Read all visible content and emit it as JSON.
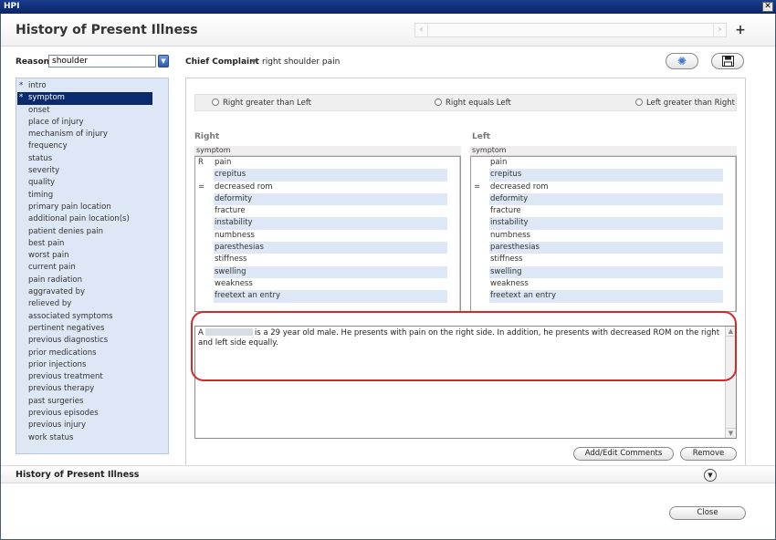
{
  "window": {
    "title": "HPI",
    "close_glyph": "✕"
  },
  "header": {
    "title": "History of Present Illness",
    "nav_left": "‹",
    "nav_right": "›",
    "add_glyph": "+"
  },
  "reason": {
    "label": "Reason:",
    "value": "shoulder"
  },
  "chief_complaint": {
    "label": "Chief Complaint",
    "value": "right shoulder pain"
  },
  "sidebar": {
    "items": [
      {
        "label": "intro",
        "star": "*"
      },
      {
        "label": "symptom",
        "star": "*"
      },
      {
        "label": "onset",
        "star": ""
      },
      {
        "label": "place of injury",
        "star": ""
      },
      {
        "label": "mechanism of injury",
        "star": ""
      },
      {
        "label": "frequency",
        "star": ""
      },
      {
        "label": "status",
        "star": ""
      },
      {
        "label": "severity",
        "star": ""
      },
      {
        "label": "quality",
        "star": ""
      },
      {
        "label": "timing",
        "star": ""
      },
      {
        "label": "primary pain location",
        "star": ""
      },
      {
        "label": "additional pain location(s)",
        "star": ""
      },
      {
        "label": "patient denies pain",
        "star": ""
      },
      {
        "label": "best pain",
        "star": ""
      },
      {
        "label": "worst pain",
        "star": ""
      },
      {
        "label": "current pain",
        "star": ""
      },
      {
        "label": "pain radiation",
        "star": ""
      },
      {
        "label": "aggravated by",
        "star": ""
      },
      {
        "label": "relieved by",
        "star": ""
      },
      {
        "label": "associated symptoms",
        "star": ""
      },
      {
        "label": "pertinent negatives",
        "star": ""
      },
      {
        "label": "previous diagnostics",
        "star": ""
      },
      {
        "label": "prior medications",
        "star": ""
      },
      {
        "label": "prior injections",
        "star": ""
      },
      {
        "label": "previous treatment",
        "star": ""
      },
      {
        "label": "previous therapy",
        "star": ""
      },
      {
        "label": "past surgeries",
        "star": ""
      },
      {
        "label": "previous episodes",
        "star": ""
      },
      {
        "label": "previous injury",
        "star": ""
      },
      {
        "label": "work status",
        "star": ""
      }
    ]
  },
  "radios": {
    "right_greater": "Right greater than Left",
    "equals": "Right equals Left",
    "left_greater": "Left greater than Right"
  },
  "right_col": {
    "heading": "Right",
    "column_header": "symptom",
    "rows": [
      {
        "mark": "R",
        "text": "pain"
      },
      {
        "mark": "",
        "text": "crepitus"
      },
      {
        "mark": "=",
        "text": "decreased rom"
      },
      {
        "mark": "",
        "text": "deformity"
      },
      {
        "mark": "",
        "text": "fracture"
      },
      {
        "mark": "",
        "text": "instability"
      },
      {
        "mark": "",
        "text": "numbness"
      },
      {
        "mark": "",
        "text": "paresthesias"
      },
      {
        "mark": "",
        "text": "stiffness"
      },
      {
        "mark": "",
        "text": "swelling"
      },
      {
        "mark": "",
        "text": "weakness"
      },
      {
        "mark": "",
        "text": "freetext an entry"
      }
    ]
  },
  "left_col": {
    "heading": "Left",
    "column_header": "symptom",
    "rows": [
      {
        "mark": "",
        "text": "pain"
      },
      {
        "mark": "",
        "text": "crepitus"
      },
      {
        "mark": "=",
        "text": "decreased rom"
      },
      {
        "mark": "",
        "text": "deformity"
      },
      {
        "mark": "",
        "text": "fracture"
      },
      {
        "mark": "",
        "text": "instability"
      },
      {
        "mark": "",
        "text": "numbness"
      },
      {
        "mark": "",
        "text": "paresthesias"
      },
      {
        "mark": "",
        "text": "stiffness"
      },
      {
        "mark": "",
        "text": "swelling"
      },
      {
        "mark": "",
        "text": "weakness"
      },
      {
        "mark": "",
        "text": "freetext an entry"
      }
    ]
  },
  "note": {
    "prefix": "A",
    "suffix": "is a 29 year old male.  He presents with pain on the right side.  In addition, he presents with decreased ROM on the right and left side equally."
  },
  "buttons": {
    "add_edit_comments": "Add/Edit Comments",
    "remove": "Remove",
    "close": "Close"
  },
  "bottom_section": {
    "title": "History of Present Illness",
    "expand_glyph": "▼"
  },
  "colors": {
    "selected": "#0a2a6e",
    "sidebar_bg": "#dde7f6",
    "highlight": "#d02a2a"
  }
}
